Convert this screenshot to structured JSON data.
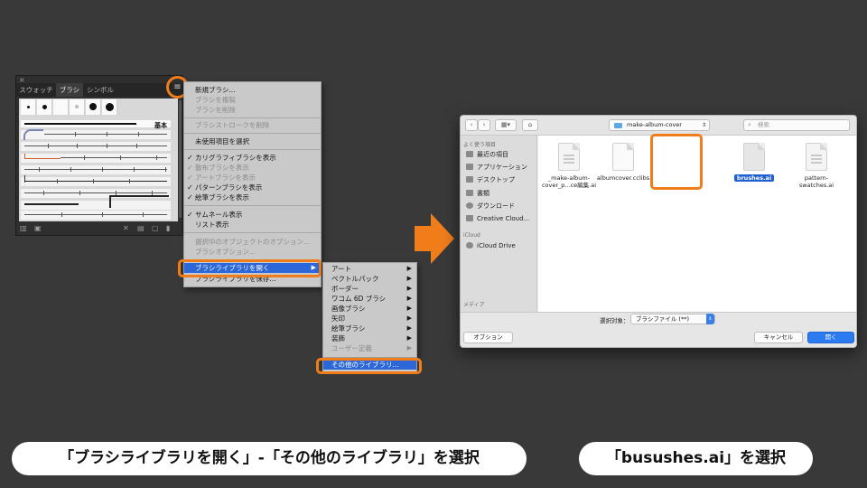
{
  "brush_panel": {
    "close_glyph": "×",
    "tabs": [
      "スウォッチ",
      "ブラシ",
      "シンボル"
    ],
    "active_tab": "ブラシ",
    "basic_brush_label": "基本",
    "menu_glyph": "≡"
  },
  "main_menu": {
    "items": [
      {
        "label": "新規ブラシ...",
        "enabled": true
      },
      {
        "label": "ブラシを複製",
        "enabled": false
      },
      {
        "label": "ブラシを削除",
        "enabled": false
      },
      {
        "label": "ブラシストロークを削除",
        "enabled": false
      },
      {
        "label": "未使用項目を選択",
        "enabled": true
      },
      {
        "label": "カリグラフィブラシを表示",
        "enabled": true,
        "checked": true
      },
      {
        "label": "散布ブラシを表示",
        "enabled": false,
        "checked": true
      },
      {
        "label": "アートブラシを表示",
        "enabled": false,
        "checked": true
      },
      {
        "label": "パターンブラシを表示",
        "enabled": true,
        "checked": true
      },
      {
        "label": "絵筆ブラシを表示",
        "enabled": true,
        "checked": true
      },
      {
        "label": "サムネール表示",
        "enabled": true,
        "checked": true
      },
      {
        "label": "リスト表示",
        "enabled": true
      },
      {
        "label": "選択中のオブジェクトのオプション...",
        "enabled": false
      },
      {
        "label": "ブラシオプション...",
        "enabled": false
      },
      {
        "label": "ブラシライブラリを開く",
        "enabled": true,
        "selected": true,
        "submenu": true
      },
      {
        "label": "ブラシライブラリを保存...",
        "enabled": true
      }
    ]
  },
  "sub_menu": {
    "items": [
      {
        "label": "アート",
        "submenu": true
      },
      {
        "label": "ベクトルパック",
        "submenu": true
      },
      {
        "label": "ボーダー",
        "submenu": true
      },
      {
        "label": "ワコム 6D ブラシ",
        "submenu": true
      },
      {
        "label": "画像ブラシ",
        "submenu": true
      },
      {
        "label": "矢印",
        "submenu": true
      },
      {
        "label": "絵筆ブラシ",
        "submenu": true
      },
      {
        "label": "装飾",
        "submenu": true
      },
      {
        "label": "ユーザー定義",
        "submenu": true,
        "enabled": false
      },
      {
        "label": "その他のライブラリ...",
        "selected": true
      }
    ],
    "submenu_arrow": "▶"
  },
  "dialog": {
    "nav_back": "‹",
    "nav_forward": "›",
    "view_label": "▦▾",
    "folder_btn": "⌂",
    "path": "make-album-cover",
    "search_placeholder": "検索",
    "search_icon": "magnifier-icon",
    "sidebar": {
      "favorites_header": "よく使う項目",
      "favorites": [
        "最近の項目",
        "アプリケーション",
        "デスクトップ",
        "書類",
        "ダウンロード",
        "Creative Cloud..."
      ],
      "icloud_header": "iCloud",
      "icloud": [
        "iCloud Drive"
      ],
      "media_header": "メディア"
    },
    "files": [
      {
        "name": "_make-album-cover_p...ce編集.ai",
        "selected": false
      },
      {
        "name": "albumcover.cclibs",
        "selected": false
      },
      {
        "name": "brushes.ai",
        "selected": true
      },
      {
        "name": "pattern-swatches.ai",
        "selected": false
      }
    ],
    "format_label": "選択対象：",
    "format_value": "ブラシファイル (**)",
    "options_btn": "オプション",
    "cancel_btn": "キャンセル",
    "open_btn": "開く"
  },
  "captions": {
    "left": "「ブラシライブラリを開く」-「その他のライブラリ」を選択",
    "right": "「busushes.ai」を選択"
  },
  "colors": {
    "highlight": "#f07d1a",
    "selection_blue": "#2b67d8",
    "background": "#393939"
  }
}
